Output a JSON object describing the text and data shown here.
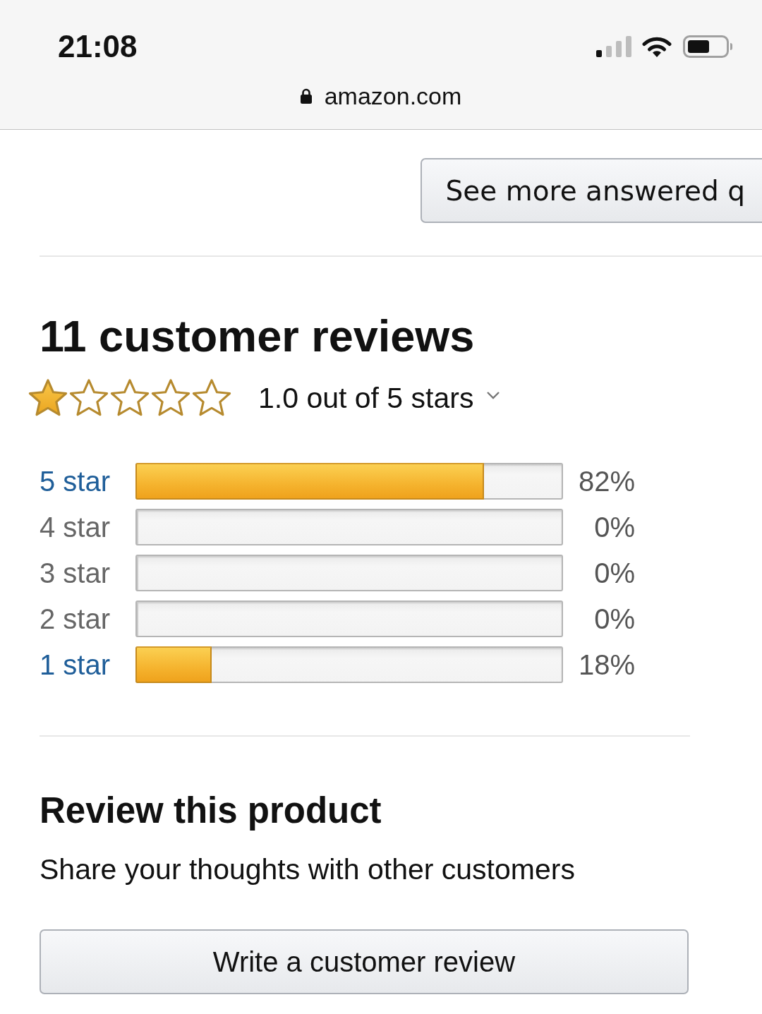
{
  "status_bar": {
    "time": "21:08"
  },
  "address_bar": {
    "url": "amazon.com",
    "secure": true
  },
  "questions": {
    "see_more_button": "See more answered q"
  },
  "reviews": {
    "title": "11 customer reviews",
    "stars": 1,
    "rating_text": "1.0 out of 5 stars",
    "histogram": [
      {
        "label": "5 star",
        "level": 0.82,
        "percent": "82%",
        "disabled": false
      },
      {
        "label": "4 star",
        "level": 0,
        "percent": "0%",
        "disabled": true
      },
      {
        "label": "3 star",
        "level": 0,
        "percent": "0%",
        "disabled": true
      },
      {
        "label": "2 star",
        "level": 0,
        "percent": "0%",
        "disabled": true
      },
      {
        "label": "1 star",
        "level": 0.18,
        "percent": "18%",
        "disabled": false
      }
    ]
  },
  "review_product": {
    "title": "Review this product",
    "subtitle": "Share your thoughts with other customers",
    "button": "Write a customer review"
  }
}
